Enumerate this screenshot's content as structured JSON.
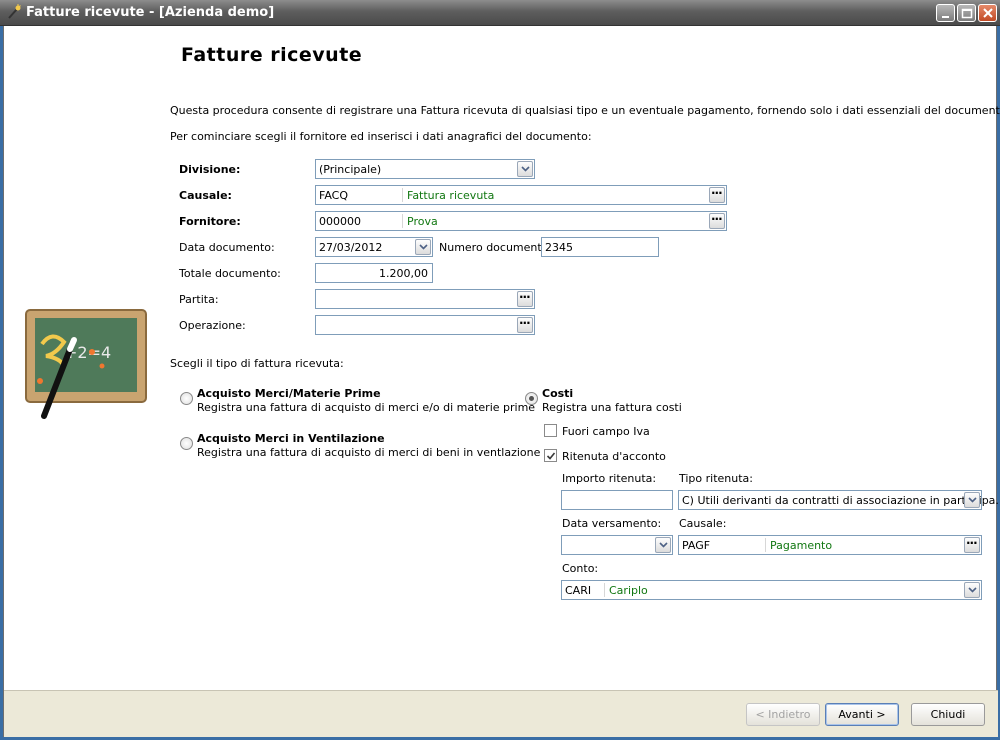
{
  "window": {
    "title": "Fatture ricevute - [Azienda demo]"
  },
  "page": {
    "title": "Fatture ricevute",
    "intro": "Questa procedura consente di registrare una Fattura ricevuta di qualsiasi tipo e un eventuale pagamento, fornendo solo i dati essenziali del documento.",
    "instruction": "Per cominciare scegli il fornitore ed inserisci i dati anagrafici del documento:"
  },
  "form": {
    "divisione": {
      "label": "Divisione:",
      "value": "(Principale)"
    },
    "causale": {
      "label": "Causale:",
      "code": "FACQ",
      "description": "Fattura ricevuta"
    },
    "fornitore": {
      "label": "Fornitore:",
      "code": "000000",
      "description": "Prova"
    },
    "data_documento": {
      "label": "Data documento:",
      "value": "27/03/2012"
    },
    "numero_documento": {
      "label": "Numero documento:",
      "value": "2345"
    },
    "totale_documento": {
      "label": "Totale documento:",
      "value": "1.200,00"
    },
    "partita": {
      "label": "Partita:",
      "value": ""
    },
    "operazione": {
      "label": "Operazione:",
      "value": ""
    }
  },
  "invoice_type": {
    "prompt": "Scegli il tipo di fattura ricevuta:",
    "options": [
      {
        "title": "Acquisto Merci/Materie Prime",
        "subtitle": "Registra una fattura di acquisto di merci e/o di materie prime",
        "selected": false
      },
      {
        "title": "Acquisto Merci in Ventilazione",
        "subtitle": "Registra una fattura di acquisto di merci di beni in ventlazione",
        "selected": false
      },
      {
        "title": "Costi",
        "subtitle": "Registra una fattura costi",
        "selected": true
      }
    ]
  },
  "costi": {
    "fuori_campo_iva": {
      "label": "Fuori campo Iva",
      "checked": false
    },
    "ritenuta_acconto": {
      "label": "Ritenuta d'acconto",
      "checked": true
    },
    "importo_ritenuta": {
      "label": "Importo ritenuta:",
      "value": ""
    },
    "tipo_ritenuta": {
      "label": "Tipo ritenuta:",
      "value": "C) Utili derivanti da contratti di associazione in partecipa..."
    },
    "data_versamento": {
      "label": "Data versamento:",
      "value": ""
    },
    "causale": {
      "label": "Causale:",
      "code": "PAGF",
      "description": "Pagamento"
    },
    "conto": {
      "label": "Conto:",
      "code": "CARI",
      "description": "Cariplo"
    }
  },
  "footer": {
    "back_label": "< Indietro",
    "next_label": "Avanti >",
    "close_label": "Chiudi"
  },
  "colors": {
    "description_text": "#117711",
    "field_border": "#7f9db9",
    "footer_bg": "#ece9d8"
  }
}
